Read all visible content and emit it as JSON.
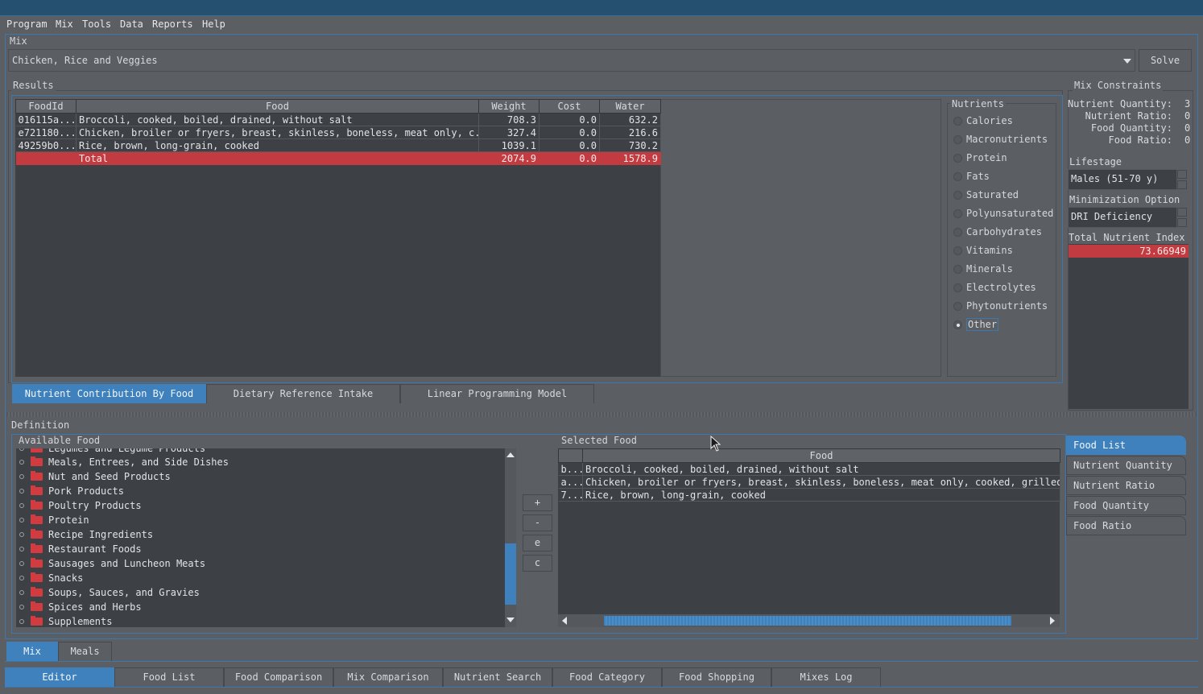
{
  "menu": [
    "Program",
    "Mix",
    "Tools",
    "Data",
    "Reports",
    "Help"
  ],
  "mix": {
    "group_label": "Mix",
    "selected": "Chicken, Rice and Veggies",
    "solve_label": "Solve"
  },
  "results": {
    "group_label": "Results",
    "columns": [
      "FoodId",
      "Food",
      "Weight",
      "Cost",
      "Water"
    ],
    "rows": [
      {
        "id": "016115a...",
        "food": "Broccoli, cooked, boiled, drained, without salt",
        "weight": "708.3",
        "cost": "0.0",
        "water": "632.2"
      },
      {
        "id": "e721180...",
        "food": "Chicken, broiler or fryers, breast, skinless, boneless, meat only, c...",
        "weight": "327.4",
        "cost": "0.0",
        "water": "216.6"
      },
      {
        "id": "49259b0...",
        "food": "Rice, brown, long-grain, cooked",
        "weight": "1039.1",
        "cost": "0.0",
        "water": "730.2"
      }
    ],
    "total": {
      "id": "",
      "food": "Total",
      "weight": "2074.9",
      "cost": "0.0",
      "water": "1578.9"
    }
  },
  "nutrients": {
    "label": "Nutrients",
    "options": [
      "Calories",
      "Macronutrients",
      "Protein",
      "Fats",
      "Saturated",
      "Polyunsaturated",
      "Carbohydrates",
      "Vitamins",
      "Minerals",
      "Electrolytes",
      "Phytonutrients",
      "Other"
    ],
    "selected": "Other"
  },
  "result_tabs": [
    "Nutrient Contribution By Food",
    "Dietary Reference Intake",
    "Linear Programming Model"
  ],
  "constraints": {
    "label": "Mix Constraints",
    "items": [
      {
        "key": "Nutrient Quantity:",
        "value": "3"
      },
      {
        "key": "Nutrient Ratio:",
        "value": "0"
      },
      {
        "key": "Food Quantity:",
        "value": "0"
      },
      {
        "key": "Food Ratio:",
        "value": "0"
      }
    ]
  },
  "lifestage": {
    "label": "Lifestage",
    "value": "Males (51-70 y)"
  },
  "minimization": {
    "label": "Minimization Option",
    "value": "DRI Deficiency"
  },
  "tni": {
    "label": "Total Nutrient Index",
    "value": "73.66949"
  },
  "definition": {
    "label": "Definition",
    "available_label": "Available Food",
    "partial_top": "Legumes and Legume Products",
    "categories": [
      "Meals, Entrees, and Side Dishes",
      "Nut and Seed Products",
      "Pork Products",
      "Poultry Products",
      "Protein",
      "Recipe Ingredients",
      "Restaurant Foods",
      "Sausages and Luncheon Meats",
      "Snacks",
      "Soups, Sauces, and Gravies",
      "Spices and Herbs",
      "Supplements"
    ],
    "buttons": [
      "+",
      "-",
      "e",
      "c"
    ],
    "selected_label": "Selected Food",
    "selected_column": "Food",
    "selected_rows": [
      {
        "id": "b...",
        "food": "Broccoli, cooked, boiled, drained, without salt"
      },
      {
        "id": "a...",
        "food": "Chicken, broiler or fryers, breast, skinless, boneless, meat only, cooked, grilled"
      },
      {
        "id": "7...",
        "food": "Rice, brown, long-grain, cooked"
      }
    ],
    "side_tabs": [
      "Food List",
      "Nutrient Quantity",
      "Nutrient Ratio",
      "Food Quantity",
      "Food Ratio"
    ]
  },
  "lower_tabs": [
    "Mix",
    "Meals"
  ],
  "bottom_tabs": [
    "Editor",
    "Food List",
    "Food Comparison",
    "Mix Comparison",
    "Nutrient Search",
    "Food Category",
    "Food Shopping",
    "Mixes Log"
  ],
  "colors": {
    "accent": "#3e81bd",
    "highlight": "#c23b40",
    "background": "#5b5e62",
    "panel": "#3d4045"
  }
}
